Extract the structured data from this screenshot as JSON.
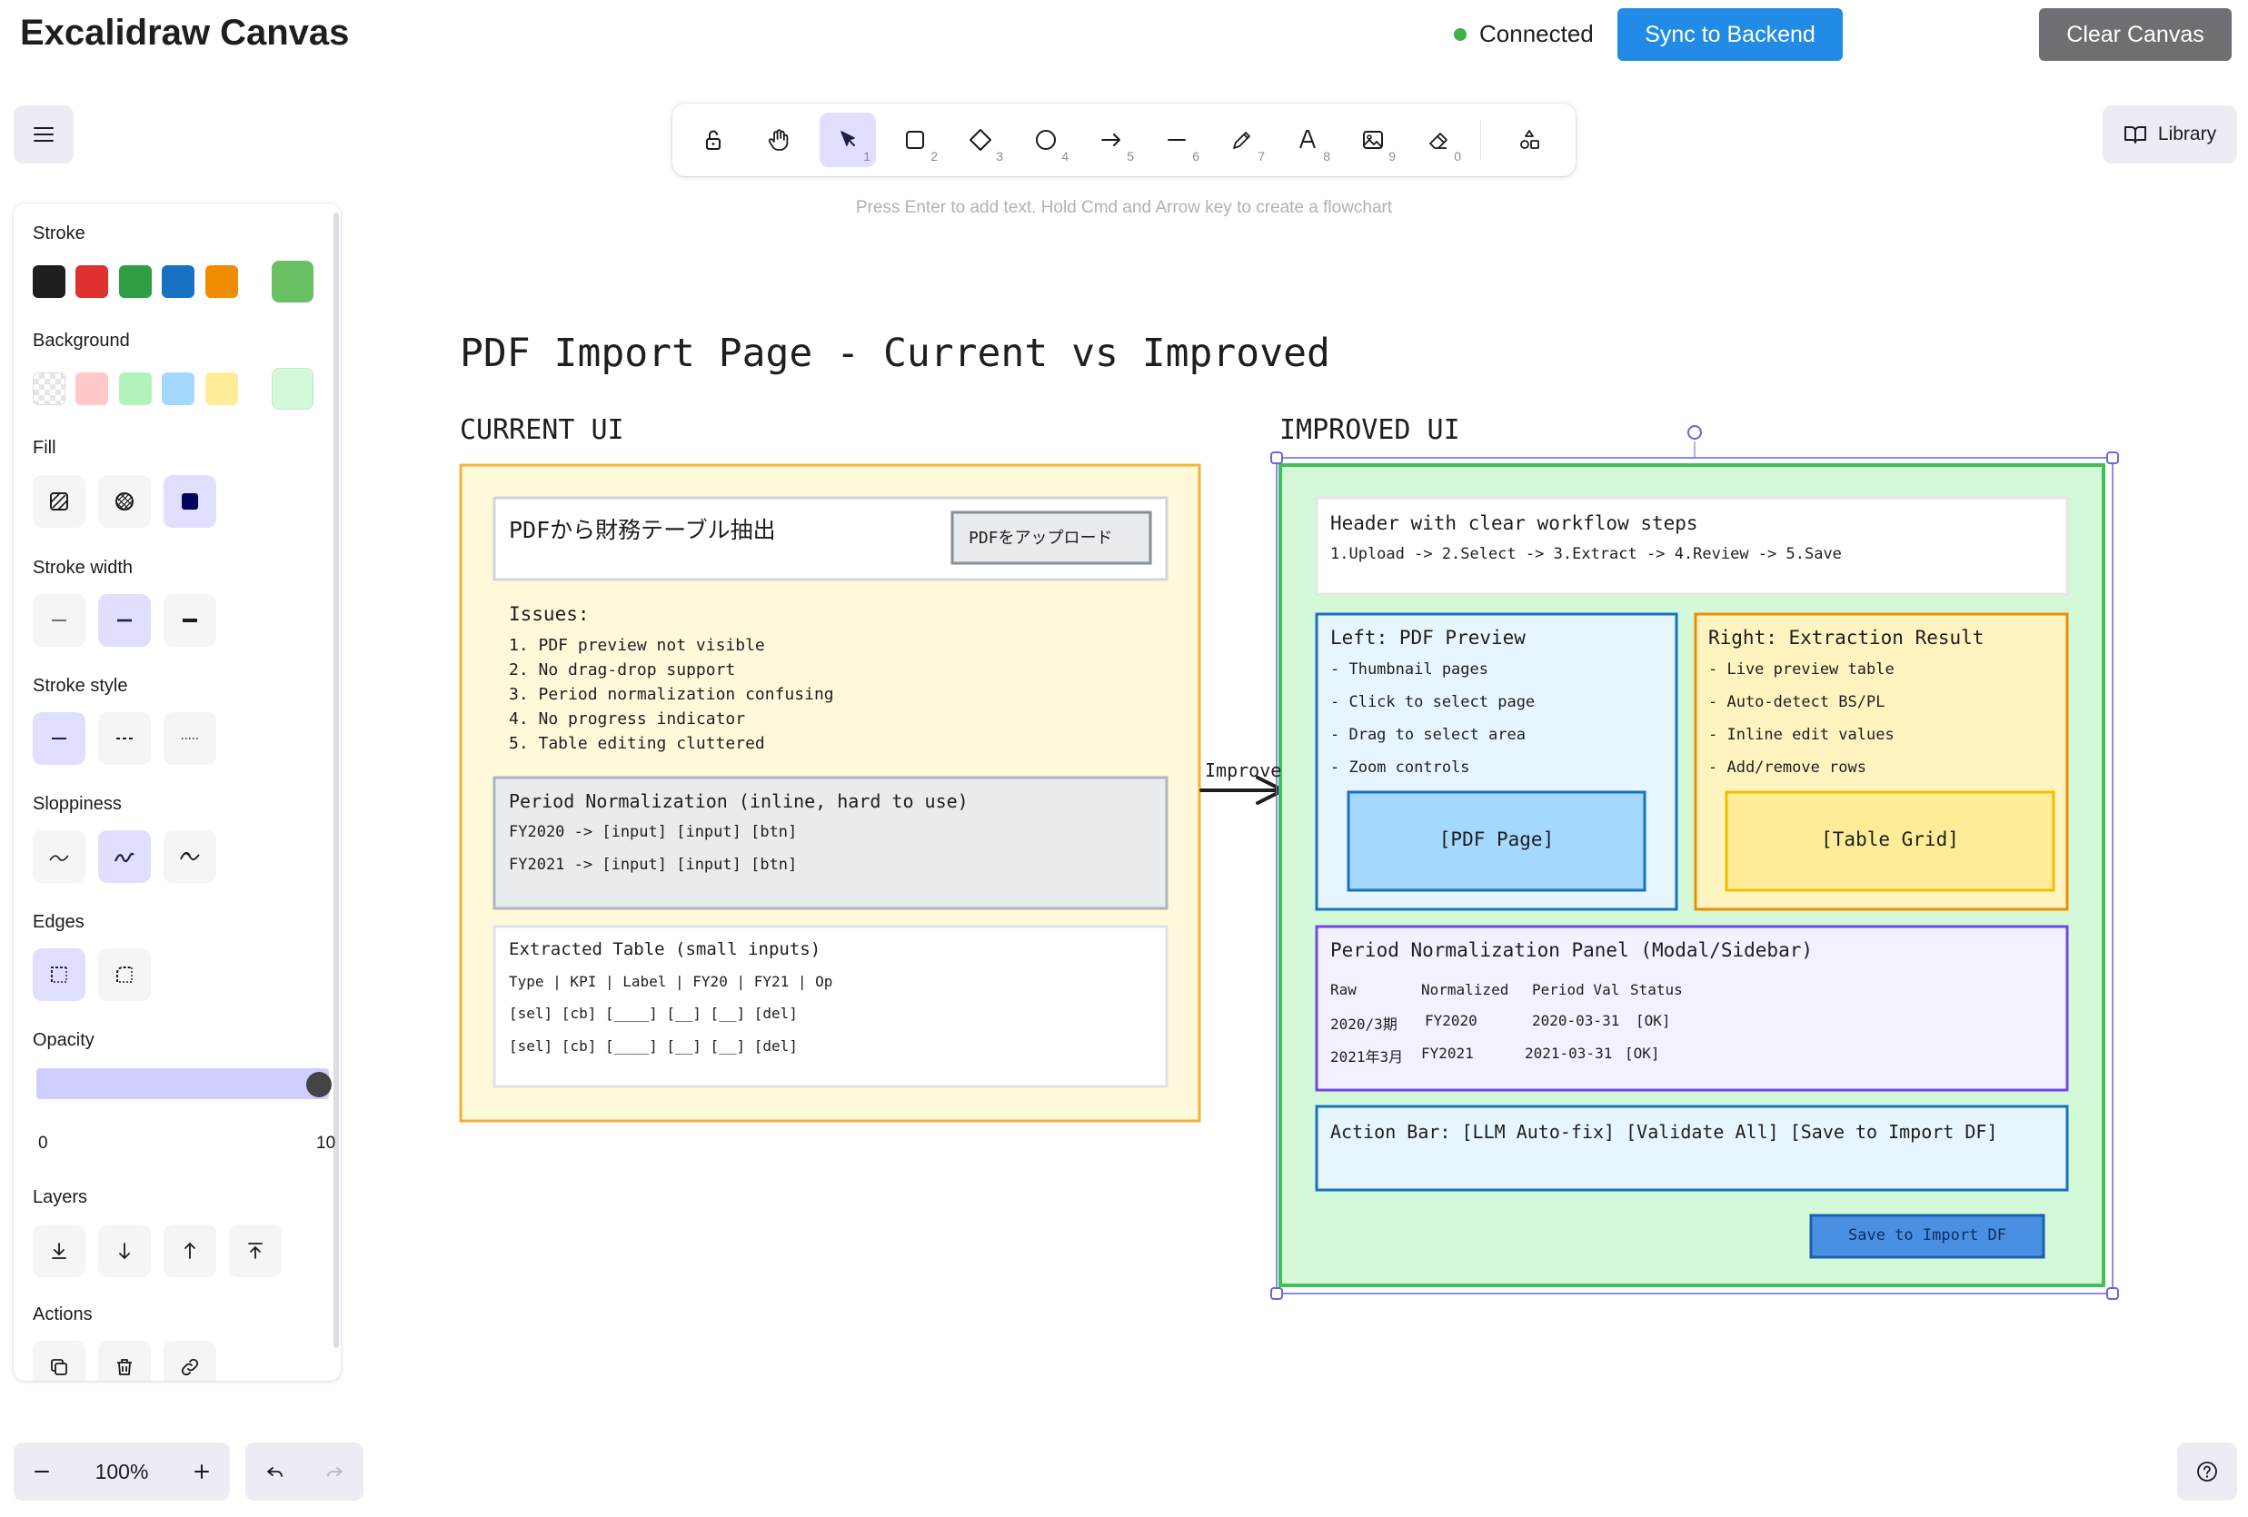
{
  "header": {
    "title": "Excalidraw Canvas",
    "status": "Connected",
    "sync_label": "Sync to Backend",
    "clear_label": "Clear Canvas"
  },
  "library": {
    "label": "Library"
  },
  "toolbar": {
    "tools": [
      {
        "name": "lock",
        "shortcut": ""
      },
      {
        "name": "hand",
        "shortcut": ""
      },
      {
        "name": "selection",
        "shortcut": "1"
      },
      {
        "name": "rectangle",
        "shortcut": "2"
      },
      {
        "name": "diamond",
        "shortcut": "3"
      },
      {
        "name": "ellipse",
        "shortcut": "4"
      },
      {
        "name": "arrow",
        "shortcut": "5"
      },
      {
        "name": "line",
        "shortcut": "6"
      },
      {
        "name": "draw",
        "shortcut": "7"
      },
      {
        "name": "text",
        "shortcut": "8"
      },
      {
        "name": "image",
        "shortcut": "9"
      },
      {
        "name": "eraser",
        "shortcut": "0"
      },
      {
        "name": "extra-tools",
        "shortcut": ""
      }
    ],
    "active": "selection",
    "hint": "Press Enter to add text. Hold Cmd and Arrow key to create a flowchart"
  },
  "properties": {
    "stroke_label": "Stroke",
    "stroke_colors": [
      "#1e1e1e",
      "#e03131",
      "#2f9e44",
      "#1971c2",
      "#f08c00"
    ],
    "stroke_current": "#69c062",
    "background_label": "Background",
    "background_colors": [
      "transparent",
      "#ffc9c9",
      "#b2f2bb",
      "#a5d8ff",
      "#ffec99"
    ],
    "background_current": "#d3f9d8",
    "fill_label": "Fill",
    "stroke_width_label": "Stroke width",
    "stroke_style_label": "Stroke style",
    "sloppiness_label": "Sloppiness",
    "edges_label": "Edges",
    "opacity_label": "Opacity",
    "opacity_min": "0",
    "opacity_max": "10",
    "opacity_value": 1.0,
    "layers_label": "Layers",
    "actions_label": "Actions"
  },
  "zoom": {
    "level": "100%"
  },
  "canvas": {
    "title": "PDF Import Page - Current vs Improved",
    "current_label": "CURRENT UI",
    "improved_label": "IMPROVED UI",
    "arrow_label": "Improve",
    "current": {
      "header_title": "PDFから財務テーブル抽出",
      "upload_button": "PDFをアップロード",
      "issues_title": "Issues:",
      "issues": [
        "1. PDF preview not visible",
        "2. No drag-drop support",
        "3. Period normalization confusing",
        "4. No progress indicator",
        "5. Table editing cluttered"
      ],
      "period_title": "Period Normalization (inline, hard to use)",
      "period_lines": [
        "FY2020 -> [input] [input] [btn]",
        "FY2021 -> [input] [input] [btn]"
      ],
      "table_title": "Extracted Table (small inputs)",
      "table_lines": [
        "Type | KPI | Label | FY20 | FY21 | Op",
        "[sel] [cb] [____] [__] [__] [del]",
        "[sel] [cb] [____] [__] [__] [del]"
      ]
    },
    "improved": {
      "header_title": "Header with clear workflow steps",
      "header_steps": "1.Upload -> 2.Select -> 3.Extract -> 4.Review -> 5.Save",
      "left_title": "Left: PDF Preview",
      "left_items": [
        "- Thumbnail pages",
        "- Click to select page",
        "- Drag to select area",
        "- Zoom controls"
      ],
      "left_box": "[PDF Page]",
      "right_title": "Right: Extraction Result",
      "right_items": [
        "- Live preview table",
        "- Auto-detect BS/PL",
        "- Inline edit values",
        "- Add/remove rows"
      ],
      "right_box": "[Table Grid]",
      "period_title": "Period Normalization Panel (Modal/Sidebar)",
      "period_headers": [
        "Raw",
        "Normalized",
        "Period Val",
        "Status"
      ],
      "period_rows": [
        [
          "2020/3期",
          "FY2020",
          "2020-03-31",
          "[OK]"
        ],
        [
          "2021年3月",
          "FY2021",
          "2021-03-31",
          "[OK]"
        ]
      ],
      "action_bar": "Action Bar: [LLM Auto-fix] [Validate All] [Save to Import DF]",
      "save_button": "Save to Import DF"
    }
  }
}
